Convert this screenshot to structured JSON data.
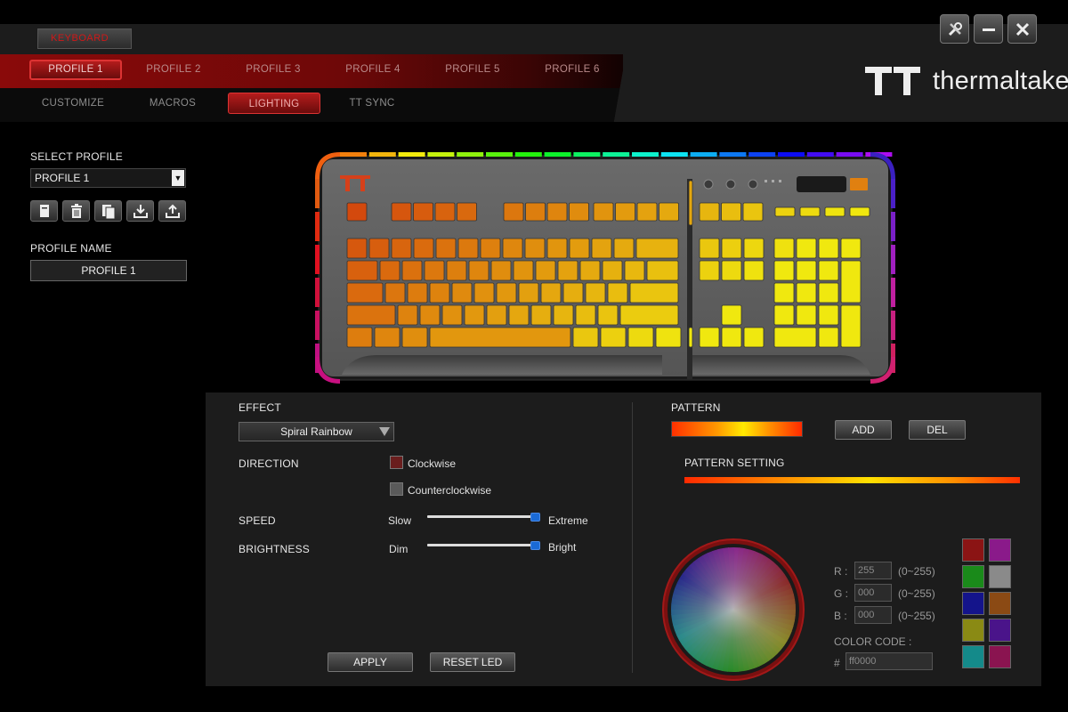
{
  "top": {
    "keyboard_tab": "KEYBOARD",
    "profile_tabs": [
      "PROFILE 1",
      "PROFILE 2",
      "PROFILE 3",
      "PROFILE 4",
      "PROFILE 5",
      "PROFILE 6"
    ],
    "sub_tabs": [
      "CUSTOMIZE",
      "MACROS",
      "LIGHTING",
      "TT SYNC"
    ],
    "active_profile_tab": "PROFILE 1",
    "active_sub_tab": "LIGHTING",
    "logo_text": "thermaltake"
  },
  "left": {
    "select_profile_label": "SELECT PROFILE",
    "selected_profile": "PROFILE 1",
    "profile_name_label": "PROFILE NAME",
    "profile_name_value": "PROFILE 1"
  },
  "effect": {
    "effect_label": "EFFECT",
    "effect_value": "Spiral Rainbow",
    "direction_label": "DIRECTION",
    "clockwise": "Clockwise",
    "counterclockwise": "Counterclockwise",
    "speed_label": "SPEED",
    "speed_min": "Slow",
    "speed_max": "Extreme",
    "speed_level": 1.0,
    "brightness_label": "BRIGHTNESS",
    "brightness_min": "Dim",
    "brightness_max": "Bright",
    "brightness_level": 1.0,
    "apply": "APPLY",
    "reset": "RESET LED"
  },
  "pattern": {
    "pattern_label": "PATTERN",
    "add": "ADD",
    "del": "DEL",
    "pattern_setting_label": "PATTERN SETTING",
    "r_label": "R :",
    "g_label": "G :",
    "b_label": "B :",
    "r_value": "255",
    "g_value": "000",
    "b_value": "000",
    "range": "(0~255)",
    "color_code_label": "COLOR CODE :",
    "hash": "#",
    "color_code_value": "ff0000",
    "swatches": [
      "#8b1414",
      "#8a1a8a",
      "#1a8a1a",
      "#8a8a8a",
      "#14148b",
      "#8b4a14",
      "#8a8a14",
      "#4a148a",
      "#148a8a",
      "#8a1450"
    ]
  },
  "colors": {
    "accent_red": "#c81818",
    "panel": "#1c1c1c"
  }
}
